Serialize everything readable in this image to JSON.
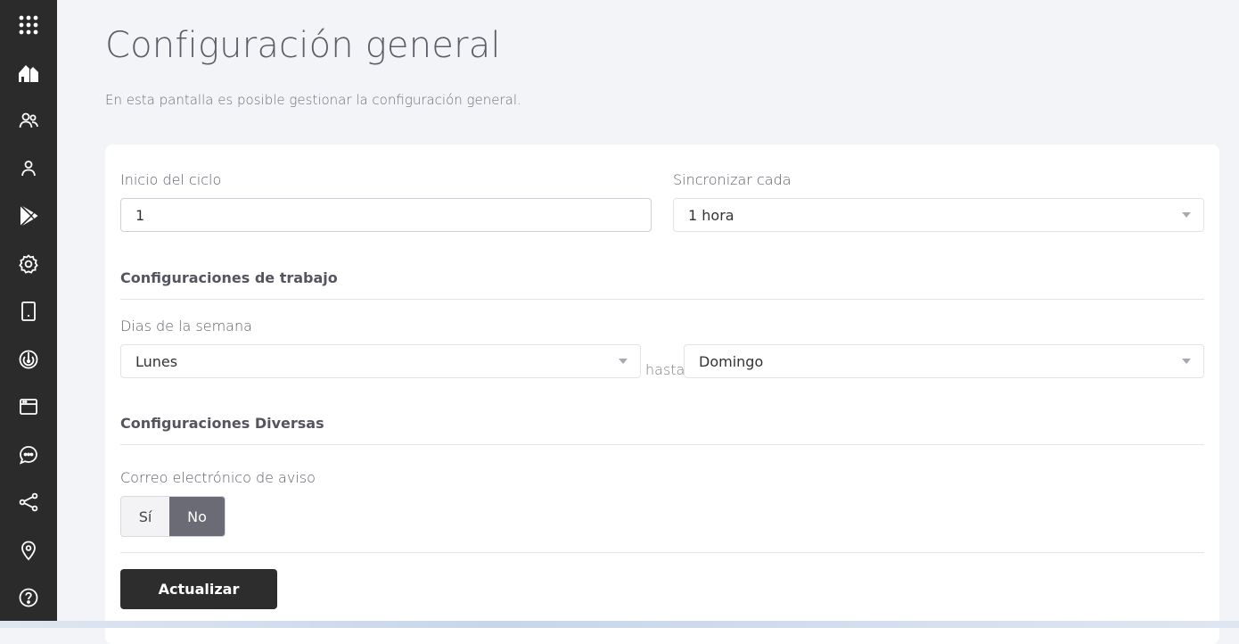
{
  "sidebar": {
    "icons": [
      {
        "name": "apps-grid-icon"
      },
      {
        "name": "home-icon"
      },
      {
        "name": "users-group-icon"
      },
      {
        "name": "user-icon"
      },
      {
        "name": "play-store-icon"
      },
      {
        "name": "settings-gear-icon"
      },
      {
        "name": "device-tablet-icon"
      },
      {
        "name": "radar-icon"
      },
      {
        "name": "browser-window-icon"
      },
      {
        "name": "chat-bubble-icon"
      },
      {
        "name": "share-icon"
      },
      {
        "name": "location-pin-icon"
      },
      {
        "name": "help-icon"
      }
    ],
    "background": "#2b2b2b"
  },
  "page": {
    "title": "Configuración general",
    "subtitle": "En esta pantalla es posible gestionar la configuración general."
  },
  "form": {
    "cycle_start": {
      "label": "Inicio del ciclo",
      "value": "1"
    },
    "sync_every": {
      "label": "Sincronizar cada",
      "selected": "1 hora"
    },
    "work_section_title": "Configuraciones de trabajo",
    "weekdays": {
      "label": "Dias de la semana",
      "from_selected": "Lunes",
      "to_label": "hasta",
      "to_selected": "Domingo"
    },
    "misc_section_title": "Configuraciones Diversas",
    "email_notice": {
      "label": "Correo electrónico de aviso",
      "yes_label": "Sí",
      "no_label": "No",
      "selected": "No"
    },
    "submit_label": "Actualizar"
  },
  "colors": {
    "page_background": "#f3f4f7",
    "card_background": "#ffffff",
    "toggle_active": "#6b6b75",
    "button_dark": "#2d2d2d"
  }
}
